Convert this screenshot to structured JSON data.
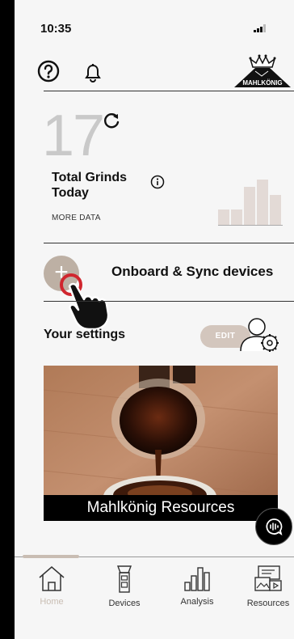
{
  "status_bar": {
    "time": "10:35"
  },
  "header": {
    "logo_text": "MAHLKÖNIG"
  },
  "grinds": {
    "count": "17",
    "label": "Total Grinds Today",
    "more_data": "MORE DATA",
    "mini_chart": {
      "type": "bar",
      "values": [
        2,
        2,
        5,
        6,
        4
      ]
    }
  },
  "onboard": {
    "plus_symbol": "+",
    "label": "Onboard & Sync devices"
  },
  "settings": {
    "title": "Your settings",
    "edit_label": "EDIT"
  },
  "resources_card": {
    "caption": "Mahlkönig Resources"
  },
  "tabs": [
    {
      "label": "Home",
      "icon": "home-icon",
      "active": true
    },
    {
      "label": "Devices",
      "icon": "grinder-icon",
      "active": false
    },
    {
      "label": "Analysis",
      "icon": "analysis-icon",
      "active": false
    },
    {
      "label": "Resources",
      "icon": "resources-icon",
      "active": false
    }
  ],
  "colors": {
    "accent": "#c9bdb3",
    "plus_button": "#bdb0a4",
    "edit_button": "#d3c6bd",
    "cursor_ring": "#d0262e"
  }
}
